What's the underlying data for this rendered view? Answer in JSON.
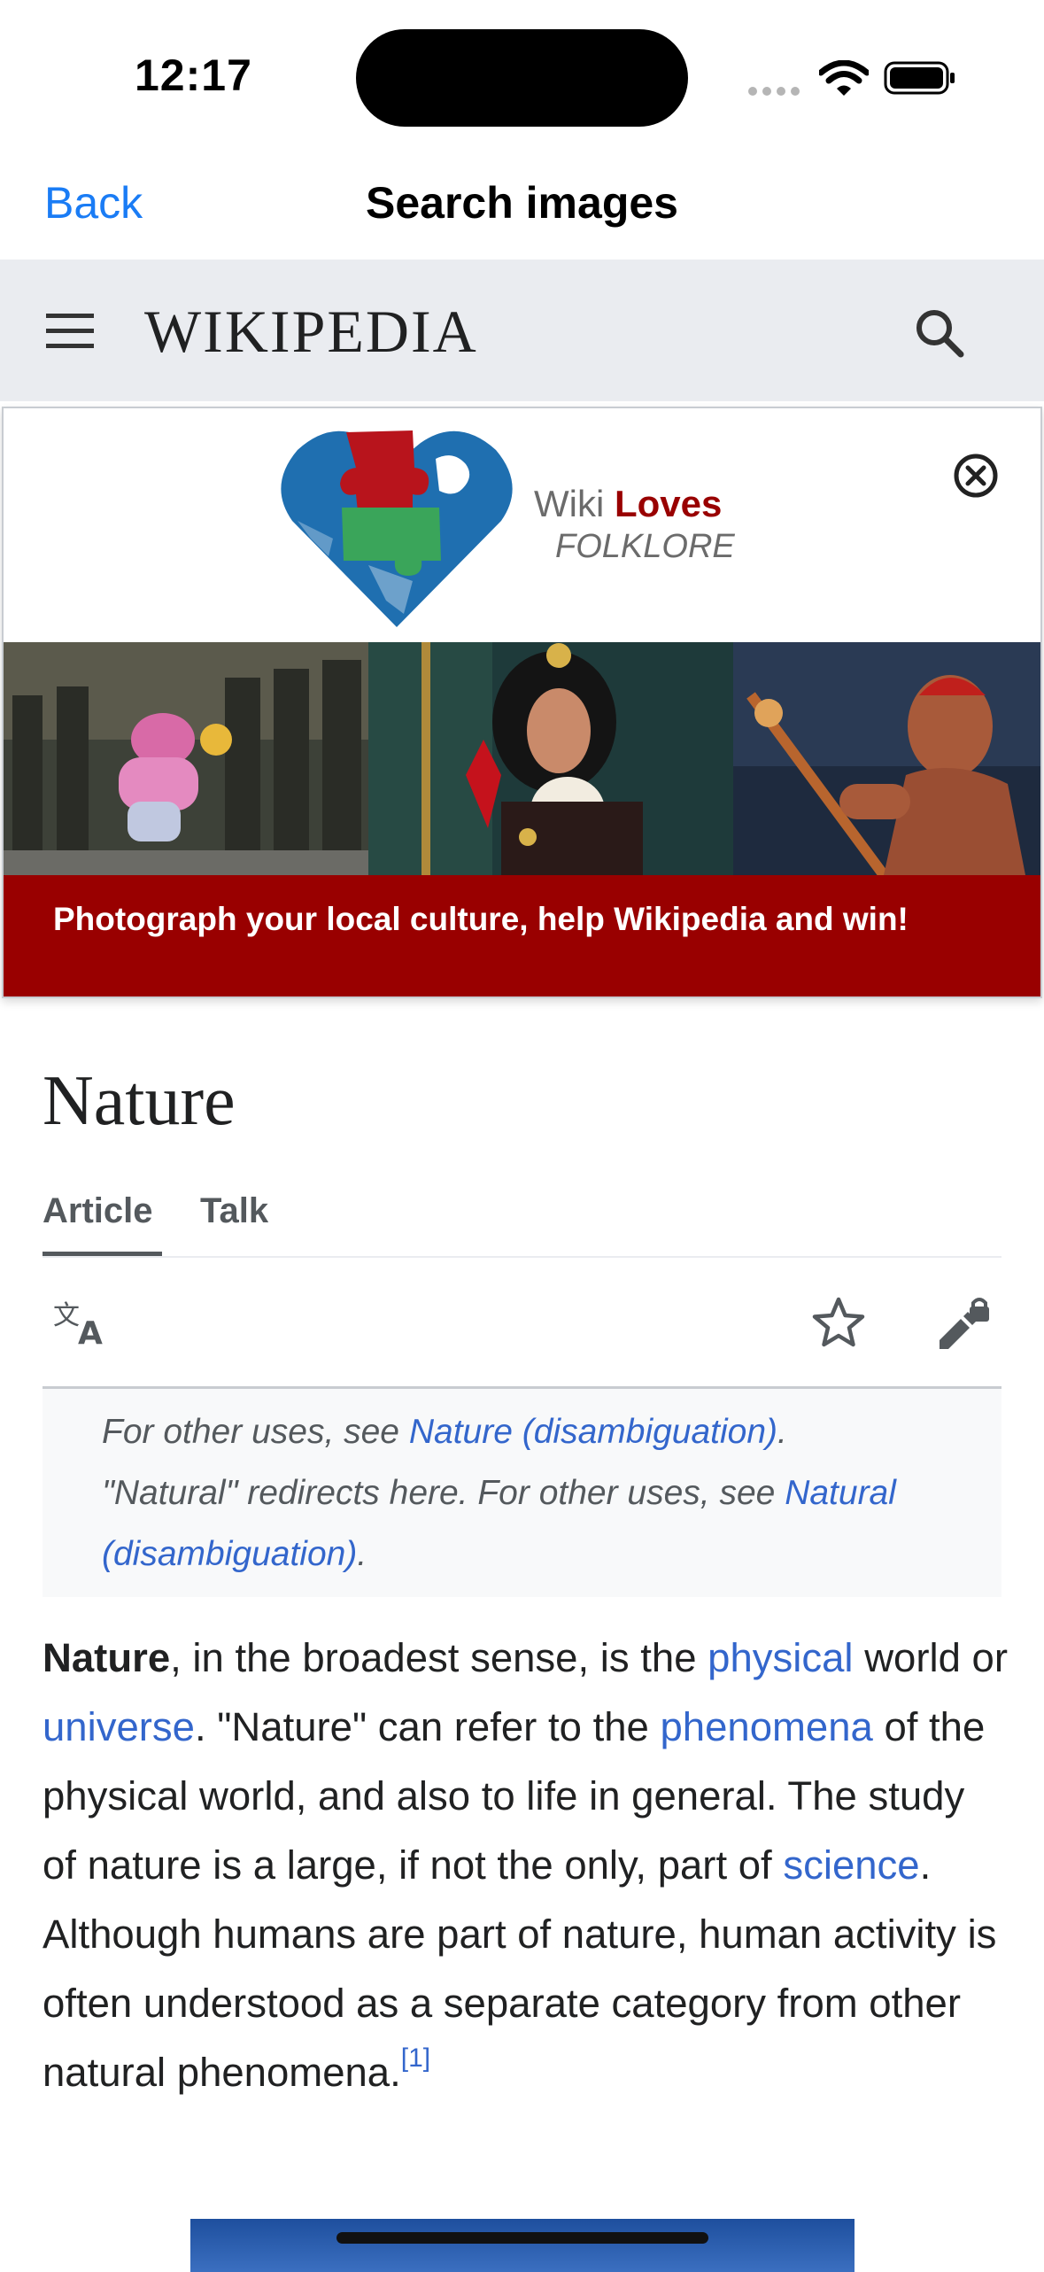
{
  "status_bar": {
    "time": "12:17"
  },
  "nav_bar": {
    "back_label": "Back",
    "title": "Search images"
  },
  "wiki_header": {
    "logo_text": "WIKIPEDIA"
  },
  "banner": {
    "logo_word1": "Wiki",
    "logo_word2": "Loves",
    "logo_word3": "FOLKLORE",
    "caption": "Photograph your local culture, help Wikipedia and win!",
    "colors": {
      "caption_bg": "#990000",
      "puzzle_blue": "#1f6fb0",
      "puzzle_red": "#b8141c",
      "puzzle_green": "#3aa55a"
    }
  },
  "article": {
    "title": "Nature",
    "tabs": [
      {
        "label": "Article",
        "selected": true
      },
      {
        "label": "Talk",
        "selected": false
      }
    ],
    "icons": [
      "translate-icon",
      "star-icon",
      "edit-lock-icon"
    ],
    "hatnotes": [
      {
        "pre": "For other uses, see ",
        "link": "Nature (disambiguation)",
        "post": "."
      },
      {
        "pre": "\"Natural\" redirects here. For other uses, see ",
        "link": "Natural (disambiguation)",
        "post": "."
      }
    ],
    "lead": {
      "bold": "Nature",
      "t1": ", in the broadest sense, is the ",
      "l1": "physical",
      "t2": " world or ",
      "l2": "universe",
      "t3": ". \"Nature\" can refer to the ",
      "l3": "phenomena",
      "t4": " of the physical world, and also to life in general. The study of nature is a large, if not the only, part of ",
      "l4": "science",
      "t5": ". Although humans are part of nature, human activity is often understood as a separate category from other natural phenomena.",
      "ref": "[1]"
    }
  },
  "colors": {
    "link": "#3366cc",
    "ios_blue": "#1a7cf5",
    "header_bg": "#eaecf0"
  }
}
